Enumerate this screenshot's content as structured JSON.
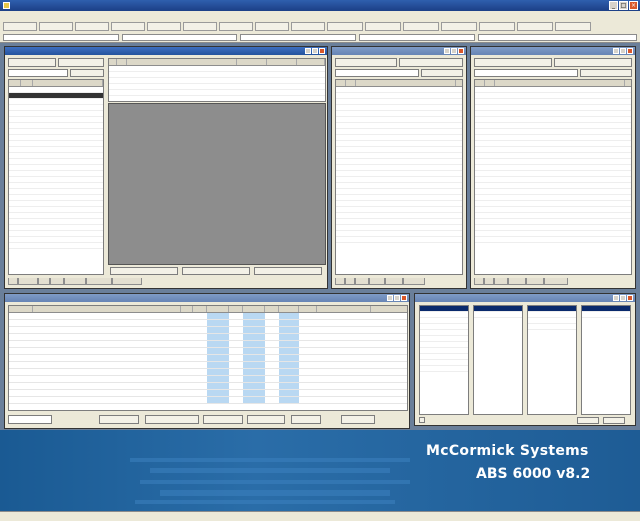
{
  "app": {
    "brand_line1": "McCormick Systems",
    "brand_line2": "ABS 6000 v8.2"
  },
  "colors": {
    "title_bar": "#24539e",
    "desktop": "#1f5f95",
    "workspace": "#6a7f9a",
    "grid_highlight": "#b9d8f2",
    "selection": "#0a2a6c"
  },
  "icons": {
    "app": "app-icon",
    "minimize": "minimize-icon",
    "maximize": "maximize-icon",
    "close": "close-icon"
  }
}
